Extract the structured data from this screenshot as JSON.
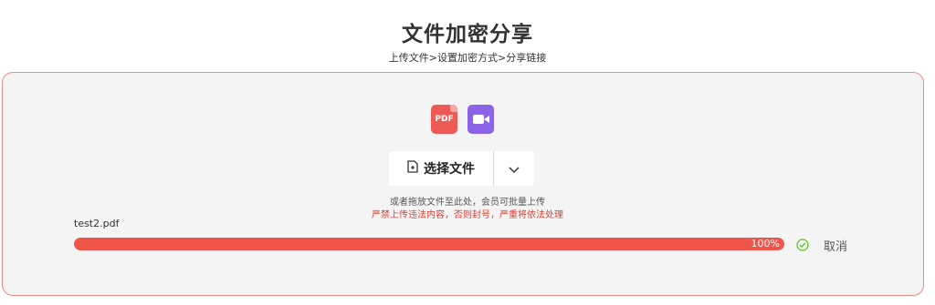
{
  "header": {
    "title": "文件加密分享",
    "breadcrumb": "上传文件>设置加密方式>分享链接"
  },
  "upload": {
    "format_icons": [
      {
        "name": "pdf-icon",
        "label": "PDF",
        "color": "#ef5a56"
      },
      {
        "name": "video-icon",
        "color": "#8a63e6"
      }
    ],
    "select_button_label": "选择文件",
    "hint": "或者拖放文件至此处，会员可批量上传",
    "warning": "严禁上传违法内容，否则封号，严重将依法处理"
  },
  "file": {
    "name": "test2.pdf",
    "progress_percent": 100,
    "progress_label": "100%",
    "cancel_label": "取消"
  },
  "colors": {
    "accent": "#f0544a",
    "warning_text": "#e33b2f",
    "success": "#52c41a"
  }
}
